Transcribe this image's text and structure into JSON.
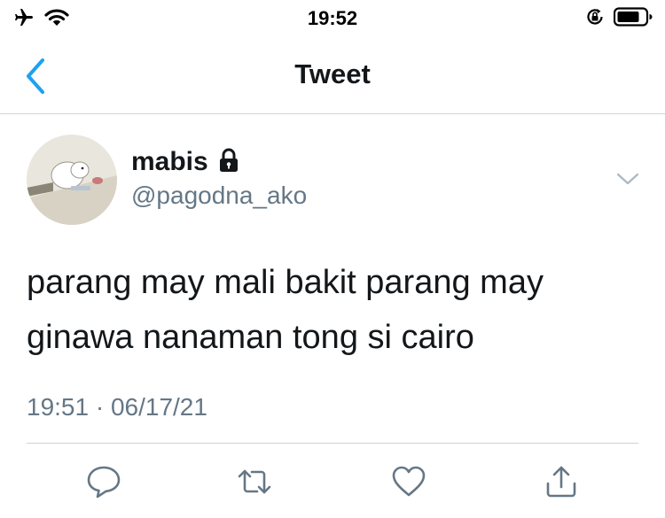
{
  "status_bar": {
    "time": "19:52",
    "icons": [
      "airplane-icon",
      "wifi-icon",
      "orientation-lock-icon",
      "battery-icon"
    ]
  },
  "nav": {
    "title": "Tweet",
    "back_icon": "chevron-left-icon"
  },
  "tweet": {
    "display_name": "mabis",
    "handle": "@pagodna_ako",
    "text": "parang may mali bakit parang may ginawa nanaman tong si cairo",
    "timestamp": "19:51 · 06/17/21",
    "protected_icon": "lock-icon",
    "more_icon": "chevron-down-icon"
  },
  "actions": [
    {
      "name": "reply-icon"
    },
    {
      "name": "retweet-icon"
    },
    {
      "name": "like-icon"
    },
    {
      "name": "share-icon"
    }
  ],
  "colors": {
    "accent": "#1da1f2",
    "text": "#14171a",
    "secondary": "#657786",
    "divider": "#cfd3d6"
  }
}
